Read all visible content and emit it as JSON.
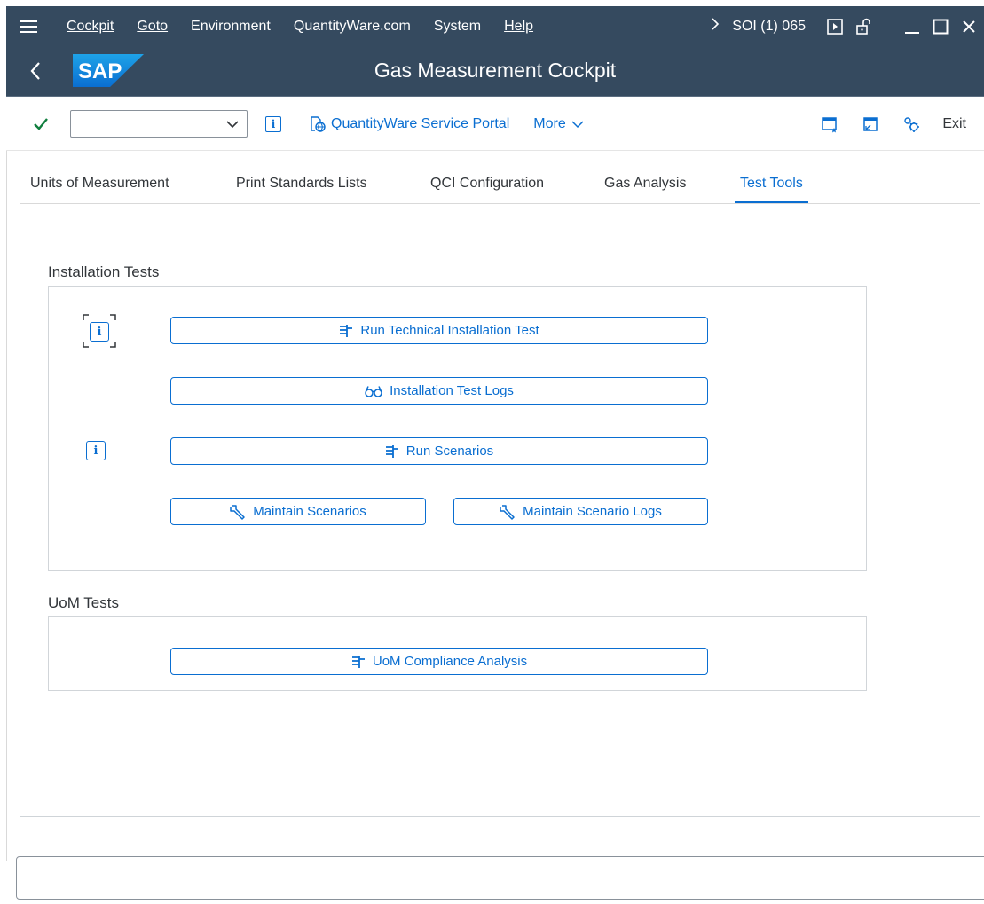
{
  "menubar": {
    "items": [
      "Cockpit",
      "Goto",
      "Environment",
      "QuantityWare.com",
      "System",
      "Help"
    ],
    "system_id": "SOI (1) 065",
    "icons": [
      "menu-icon",
      "chevron-right-icon",
      "play-icon",
      "unlock-icon",
      "minimize-icon",
      "maximize-icon",
      "close-icon"
    ]
  },
  "titlebar": {
    "title": "Gas Measurement Cockpit",
    "logo_text": "SAP"
  },
  "toolbar": {
    "command_field_value": "",
    "portal_label": "QuantityWare Service Portal",
    "more_label": "More",
    "exit_label": "Exit"
  },
  "tabs": [
    {
      "label": "Units of Measurement",
      "active": false
    },
    {
      "label": "Print Standards Lists",
      "active": false
    },
    {
      "label": "QCI Configuration",
      "active": false
    },
    {
      "label": "Gas Analysis",
      "active": false
    },
    {
      "label": "Test Tools",
      "active": true
    }
  ],
  "installation": {
    "group_label": "Installation Tests",
    "run_technical_label": "Run Technical Installation Test",
    "logs_label": "Installation Test Logs",
    "run_scenarios_label": "Run Scenarios",
    "maintain_scenarios_label": "Maintain Scenarios",
    "maintain_logs_label": "Maintain Scenario Logs"
  },
  "uom": {
    "group_label": "UoM Tests",
    "compliance_label": "UoM Compliance Analysis"
  },
  "colors": {
    "shell": "#354a5f",
    "accent": "#0a6ed1",
    "text": "#32363a",
    "check": "#107e3e"
  }
}
